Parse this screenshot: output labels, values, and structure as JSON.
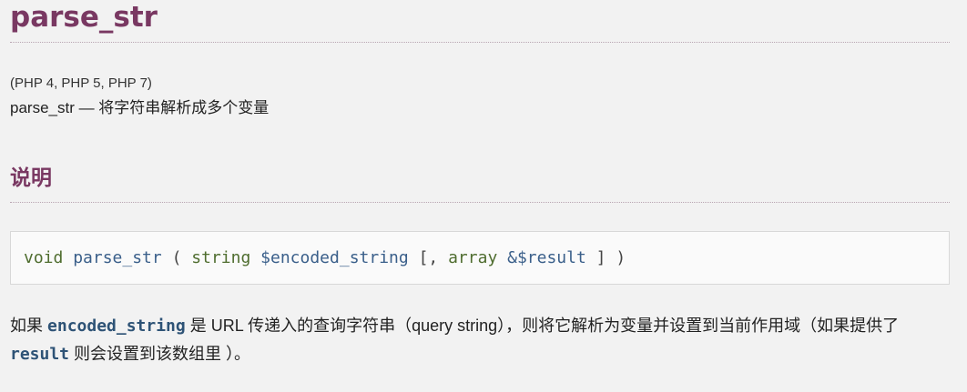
{
  "refname": "parse_str",
  "versions": "(PHP 4, PHP 5, PHP 7)",
  "purpose": "parse_str — 将字符串解析成多个变量",
  "section": {
    "title": "说明"
  },
  "synopsis": {
    "return_type": "void",
    "method": "parse_str",
    "open": "(",
    "param1_type": "string",
    "param1_name": "$encoded_string",
    "optional_open": "[,",
    "param2_type": "array",
    "param2_name": "&$result",
    "optional_close": "]",
    "close": ")"
  },
  "description": {
    "part1": "如果 ",
    "param1": "encoded_string",
    "part2": " 是 URL 传递入的查询字符串（query string），则将它解析为变量并设置到当前作用域（如果提供了 ",
    "param2": "result",
    "part3": " 则会设置到该数组里 ）。"
  }
}
